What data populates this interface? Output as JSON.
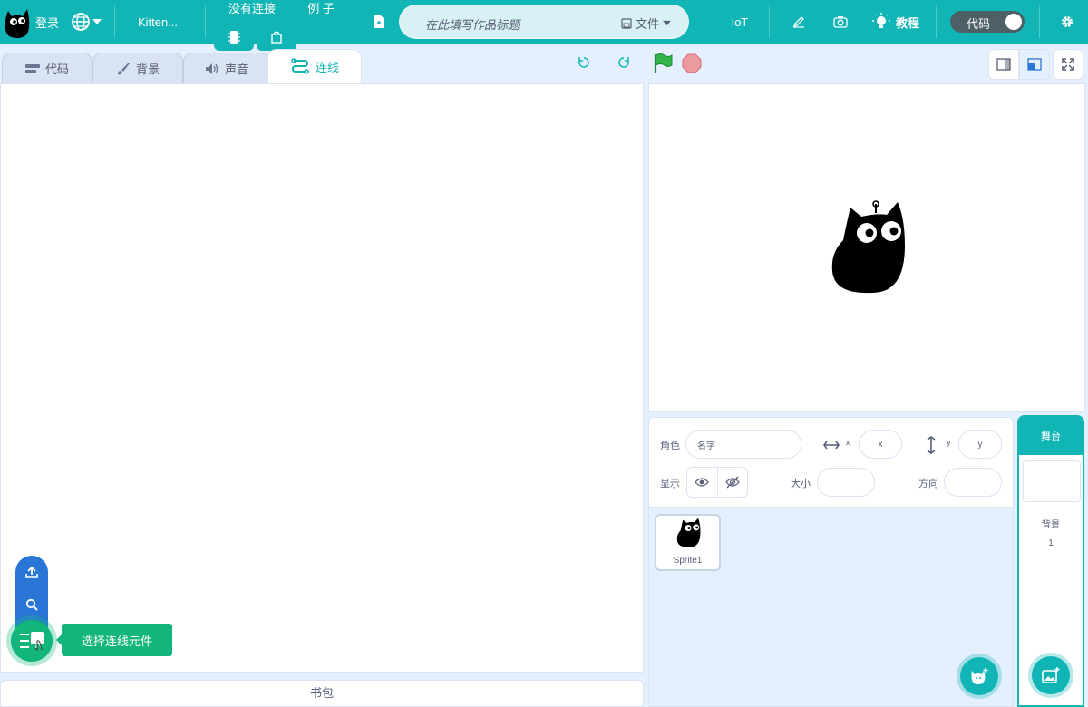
{
  "menubar": {
    "login": "登录",
    "project_name": "Kitten...",
    "connection": "没有连接",
    "examples": "例 子",
    "title_placeholder": "在此填写作品标题",
    "file": "文件",
    "iot": "IoT",
    "tutorial": "教程",
    "code_toggle": "代码"
  },
  "tabs": {
    "code": "代码",
    "backdrop": "背景",
    "sound": "声音",
    "wiring": "连线"
  },
  "workspace": {
    "tooltip": "选择连线元件",
    "backpack": "书包"
  },
  "sprite_info": {
    "sprite_label": "角色",
    "name_placeholder": "名字",
    "x_label": "x",
    "x_placeholder": "x",
    "y_label": "y",
    "y_placeholder": "y",
    "show_label": "显示",
    "size_label": "大小",
    "direction_label": "方向"
  },
  "sprites": [
    {
      "name": "Sprite1"
    }
  ],
  "stage_panel": {
    "header": "舞台",
    "backdrop_label": "背景",
    "backdrop_count": "1"
  },
  "colors": {
    "brand": "#12b5b5",
    "accent_green": "#12b57a",
    "accent_blue": "#2a76d6"
  }
}
